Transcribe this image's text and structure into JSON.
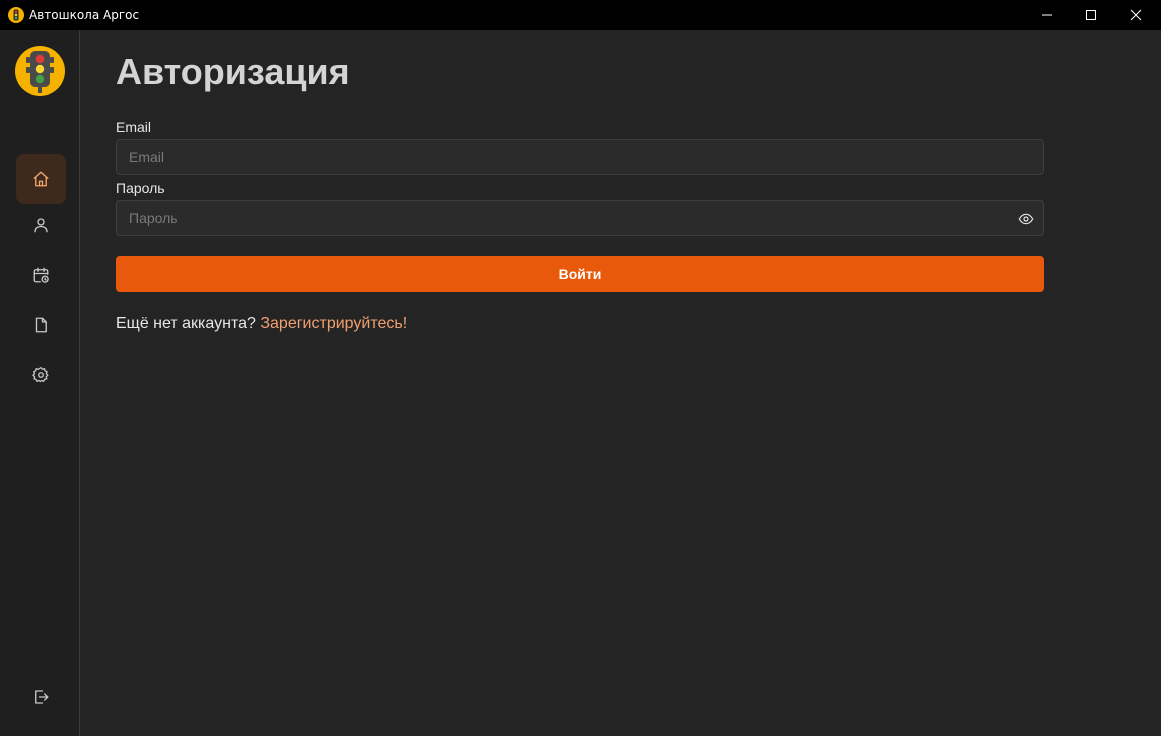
{
  "window": {
    "title": "Автошкола Аргос"
  },
  "sidebar": {
    "items": [
      {
        "id": "home",
        "icon": "home-icon",
        "active": true
      },
      {
        "id": "profile",
        "icon": "user-icon",
        "active": false
      },
      {
        "id": "schedule",
        "icon": "calendar-clock-icon",
        "active": false
      },
      {
        "id": "documents",
        "icon": "document-icon",
        "active": false
      },
      {
        "id": "settings",
        "icon": "gear-icon",
        "active": false
      }
    ],
    "logout_icon": "logout-icon"
  },
  "auth": {
    "title": "Авторизация",
    "email_label": "Email",
    "email_placeholder": "Email",
    "email_value": "",
    "password_label": "Пароль",
    "password_placeholder": "Пароль",
    "password_value": "",
    "login_button": "Войти",
    "register_prompt": "Ещё нет аккаунта?",
    "register_link": "Зарегистрируйтесь!"
  },
  "colors": {
    "accent": "#e8590c",
    "link": "#f0a070",
    "active_nav": "#3d2a1c",
    "nav_icon": "#c8c8c8",
    "active_icon": "#f5a66b",
    "background": "#242424",
    "sidebar_background": "#1f1f1f",
    "titlebar": "#000000",
    "logo_background": "#f5b300"
  }
}
